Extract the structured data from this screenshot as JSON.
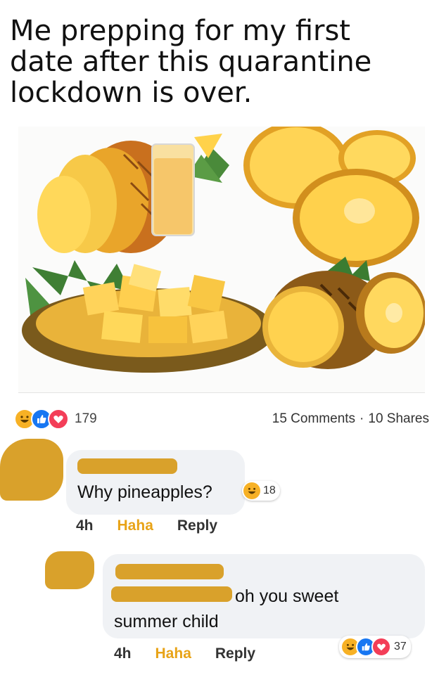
{
  "caption": "Me prepping for my first\ndate after this quarantine\nlockdown is over.",
  "post": {
    "reaction_count": "179",
    "comments": "15 Comments",
    "separator": "·",
    "shares": "10 Shares",
    "reaction_icons": [
      "haha-icon",
      "like-icon",
      "love-icon"
    ]
  },
  "comment1": {
    "text": "Why pineapples?",
    "reaction_count": "18",
    "time": "4h",
    "haha_label": "Haha",
    "reply_label": "Reply"
  },
  "comment2": {
    "text_line1": "oh you sweet",
    "text_line2": "summer child",
    "reaction_count": "37",
    "time": "4h",
    "haha_label": "Haha",
    "reply_label": "Reply"
  },
  "colors": {
    "haha": "#f7b125",
    "like": "#1877f2",
    "love": "#f33e58",
    "redaction": "#d9a12b",
    "bubble": "#f0f2f5"
  }
}
